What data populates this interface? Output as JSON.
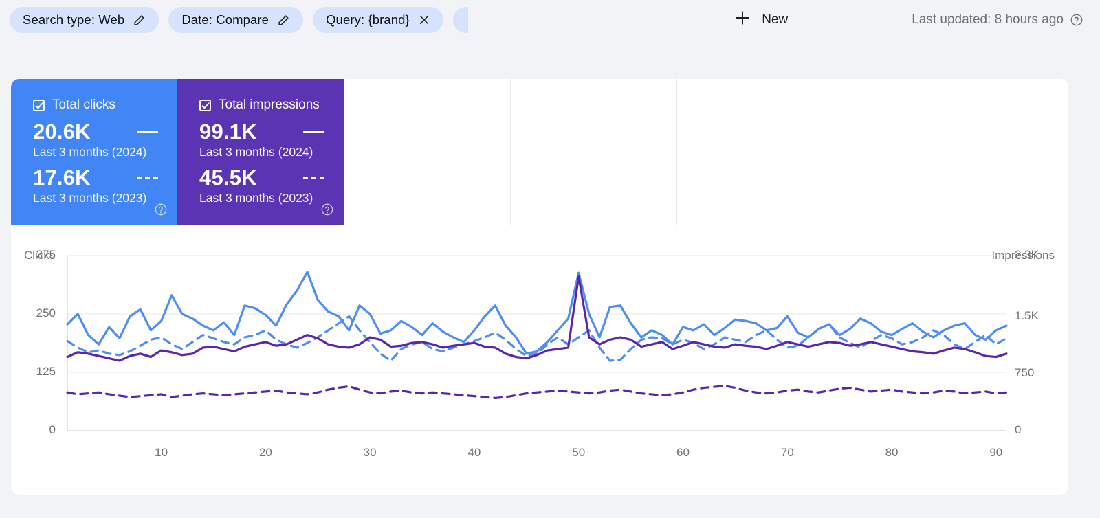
{
  "header": {
    "chips": [
      {
        "label": "Search type: Web",
        "icon": "pencil-icon"
      },
      {
        "label": "Date: Compare",
        "icon": "pencil-icon"
      },
      {
        "label": "Query: {brand}",
        "icon": "close-icon"
      }
    ],
    "new_button": {
      "label": "New",
      "icon": "plus-icon"
    },
    "last_updated": {
      "text": "Last updated: 8 hours ago",
      "icon": "help-icon"
    }
  },
  "metric_cards": [
    {
      "title": "Total clicks",
      "color": "#4285f4",
      "checked": true,
      "current": {
        "value": "20.6K",
        "label": "Last 3 months (2024)",
        "line": "solid"
      },
      "previous": {
        "value": "17.6K",
        "label": "Last 3 months (2023)",
        "line": "dashed"
      },
      "help_icon": "help-icon"
    },
    {
      "title": "Total impressions",
      "color": "#5b34b3",
      "checked": true,
      "current": {
        "value": "99.1K",
        "label": "Last 3 months (2024)",
        "line": "solid"
      },
      "previous": {
        "value": "45.5K",
        "label": "Last 3 months (2023)",
        "line": "dashed"
      },
      "help_icon": "help-icon"
    }
  ],
  "chart_data": {
    "type": "line",
    "title": "",
    "xlabel": "",
    "ylabel": "Clicks",
    "y2label": "Impressions",
    "grid": true,
    "legend_position": "cards-above",
    "x": [
      1,
      2,
      3,
      4,
      5,
      6,
      7,
      8,
      9,
      10,
      11,
      12,
      13,
      14,
      15,
      16,
      17,
      18,
      19,
      20,
      21,
      22,
      23,
      24,
      25,
      26,
      27,
      28,
      29,
      30,
      31,
      32,
      33,
      34,
      35,
      36,
      37,
      38,
      39,
      40,
      41,
      42,
      43,
      44,
      45,
      46,
      47,
      48,
      49,
      50,
      51,
      52,
      53,
      54,
      55,
      56,
      57,
      58,
      59,
      60,
      61,
      62,
      63,
      64,
      65,
      66,
      67,
      68,
      69,
      70,
      71,
      72,
      73,
      74,
      75,
      76,
      77,
      78,
      79,
      80,
      81,
      82,
      83,
      84,
      85,
      86,
      87,
      88,
      89,
      90,
      91
    ],
    "xticks": [
      10,
      20,
      30,
      40,
      50,
      60,
      70,
      80,
      90
    ],
    "ylim": [
      0,
      375
    ],
    "yticks": [
      0,
      125,
      250,
      375
    ],
    "yticklabels": [
      "0",
      "125",
      "250",
      "375"
    ],
    "y2lim": [
      0,
      2300
    ],
    "y2ticks": [
      0,
      750,
      1500,
      2300
    ],
    "y2ticklabels": [
      "0",
      "750",
      "1.5K",
      "2.3K"
    ],
    "series": [
      {
        "name": "Total clicks — Last 3 months (2024)",
        "axis": "left",
        "color": "#4e8ef4",
        "style": "solid",
        "values": [
          228,
          250,
          205,
          185,
          222,
          198,
          245,
          260,
          215,
          235,
          290,
          250,
          240,
          225,
          215,
          232,
          205,
          268,
          262,
          248,
          225,
          270,
          300,
          340,
          280,
          255,
          245,
          215,
          268,
          250,
          208,
          215,
          235,
          222,
          205,
          230,
          212,
          200,
          190,
          215,
          245,
          268,
          225,
          200,
          165,
          170,
          190,
          215,
          240,
          338,
          250,
          200,
          265,
          268,
          230,
          200,
          215,
          205,
          185,
          222,
          215,
          228,
          205,
          220,
          238,
          235,
          230,
          215,
          220,
          245,
          210,
          200,
          218,
          228,
          205,
          218,
          240,
          230,
          212,
          205,
          218,
          230,
          212,
          200,
          215,
          225,
          230,
          205,
          195,
          215,
          225
        ]
      },
      {
        "name": "Total clicks — Last 3 months (2023)",
        "axis": "left",
        "color": "#4e8ef4",
        "style": "dashed",
        "values": [
          192,
          178,
          168,
          172,
          165,
          162,
          170,
          182,
          195,
          200,
          185,
          175,
          190,
          205,
          198,
          190,
          185,
          200,
          205,
          215,
          195,
          185,
          178,
          188,
          200,
          215,
          230,
          245,
          215,
          190,
          165,
          150,
          175,
          185,
          190,
          175,
          170,
          178,
          185,
          192,
          200,
          210,
          195,
          175,
          160,
          165,
          185,
          200,
          185,
          200,
          215,
          178,
          150,
          152,
          175,
          195,
          200,
          198,
          185,
          195,
          188,
          175,
          185,
          200,
          195,
          190,
          205,
          215,
          195,
          178,
          182,
          200,
          218,
          228,
          200,
          188,
          178,
          192,
          205,
          198,
          185,
          190,
          200,
          215,
          205,
          185,
          175,
          190,
          205,
          185,
          198
        ]
      },
      {
        "name": "Total impressions — Last 3 months (2024)",
        "axis": "left",
        "color": "#5b26ab",
        "style": "solid",
        "values": [
          158,
          168,
          165,
          160,
          155,
          150,
          160,
          165,
          158,
          172,
          168,
          162,
          165,
          178,
          180,
          175,
          170,
          180,
          185,
          190,
          182,
          185,
          195,
          205,
          198,
          185,
          180,
          178,
          185,
          200,
          195,
          180,
          182,
          188,
          190,
          185,
          178,
          182,
          185,
          188,
          180,
          178,
          165,
          158,
          155,
          162,
          172,
          175,
          178,
          330,
          200,
          185,
          195,
          200,
          195,
          180,
          185,
          190,
          175,
          182,
          190,
          185,
          180,
          178,
          185,
          182,
          180,
          175,
          182,
          190,
          185,
          180,
          185,
          190,
          188,
          182,
          185,
          190,
          185,
          180,
          175,
          170,
          168,
          165,
          172,
          178,
          175,
          168,
          160,
          158,
          165
        ]
      },
      {
        "name": "Total impressions — Last 3 months (2023)",
        "axis": "left",
        "color": "#5b26ab",
        "style": "dashed",
        "values": [
          82,
          78,
          80,
          82,
          78,
          75,
          72,
          74,
          76,
          78,
          72,
          75,
          78,
          80,
          78,
          76,
          78,
          80,
          82,
          84,
          86,
          82,
          80,
          78,
          82,
          88,
          92,
          95,
          88,
          82,
          80,
          84,
          86,
          82,
          80,
          82,
          80,
          78,
          76,
          74,
          72,
          70,
          72,
          76,
          80,
          82,
          84,
          86,
          84,
          82,
          80,
          82,
          86,
          88,
          84,
          80,
          78,
          76,
          78,
          82,
          88,
          92,
          94,
          96,
          92,
          86,
          82,
          80,
          82,
          86,
          88,
          84,
          82,
          86,
          90,
          92,
          88,
          84,
          86,
          88,
          84,
          82,
          80,
          82,
          86,
          84,
          80,
          82,
          84,
          80,
          82
        ]
      }
    ]
  }
}
